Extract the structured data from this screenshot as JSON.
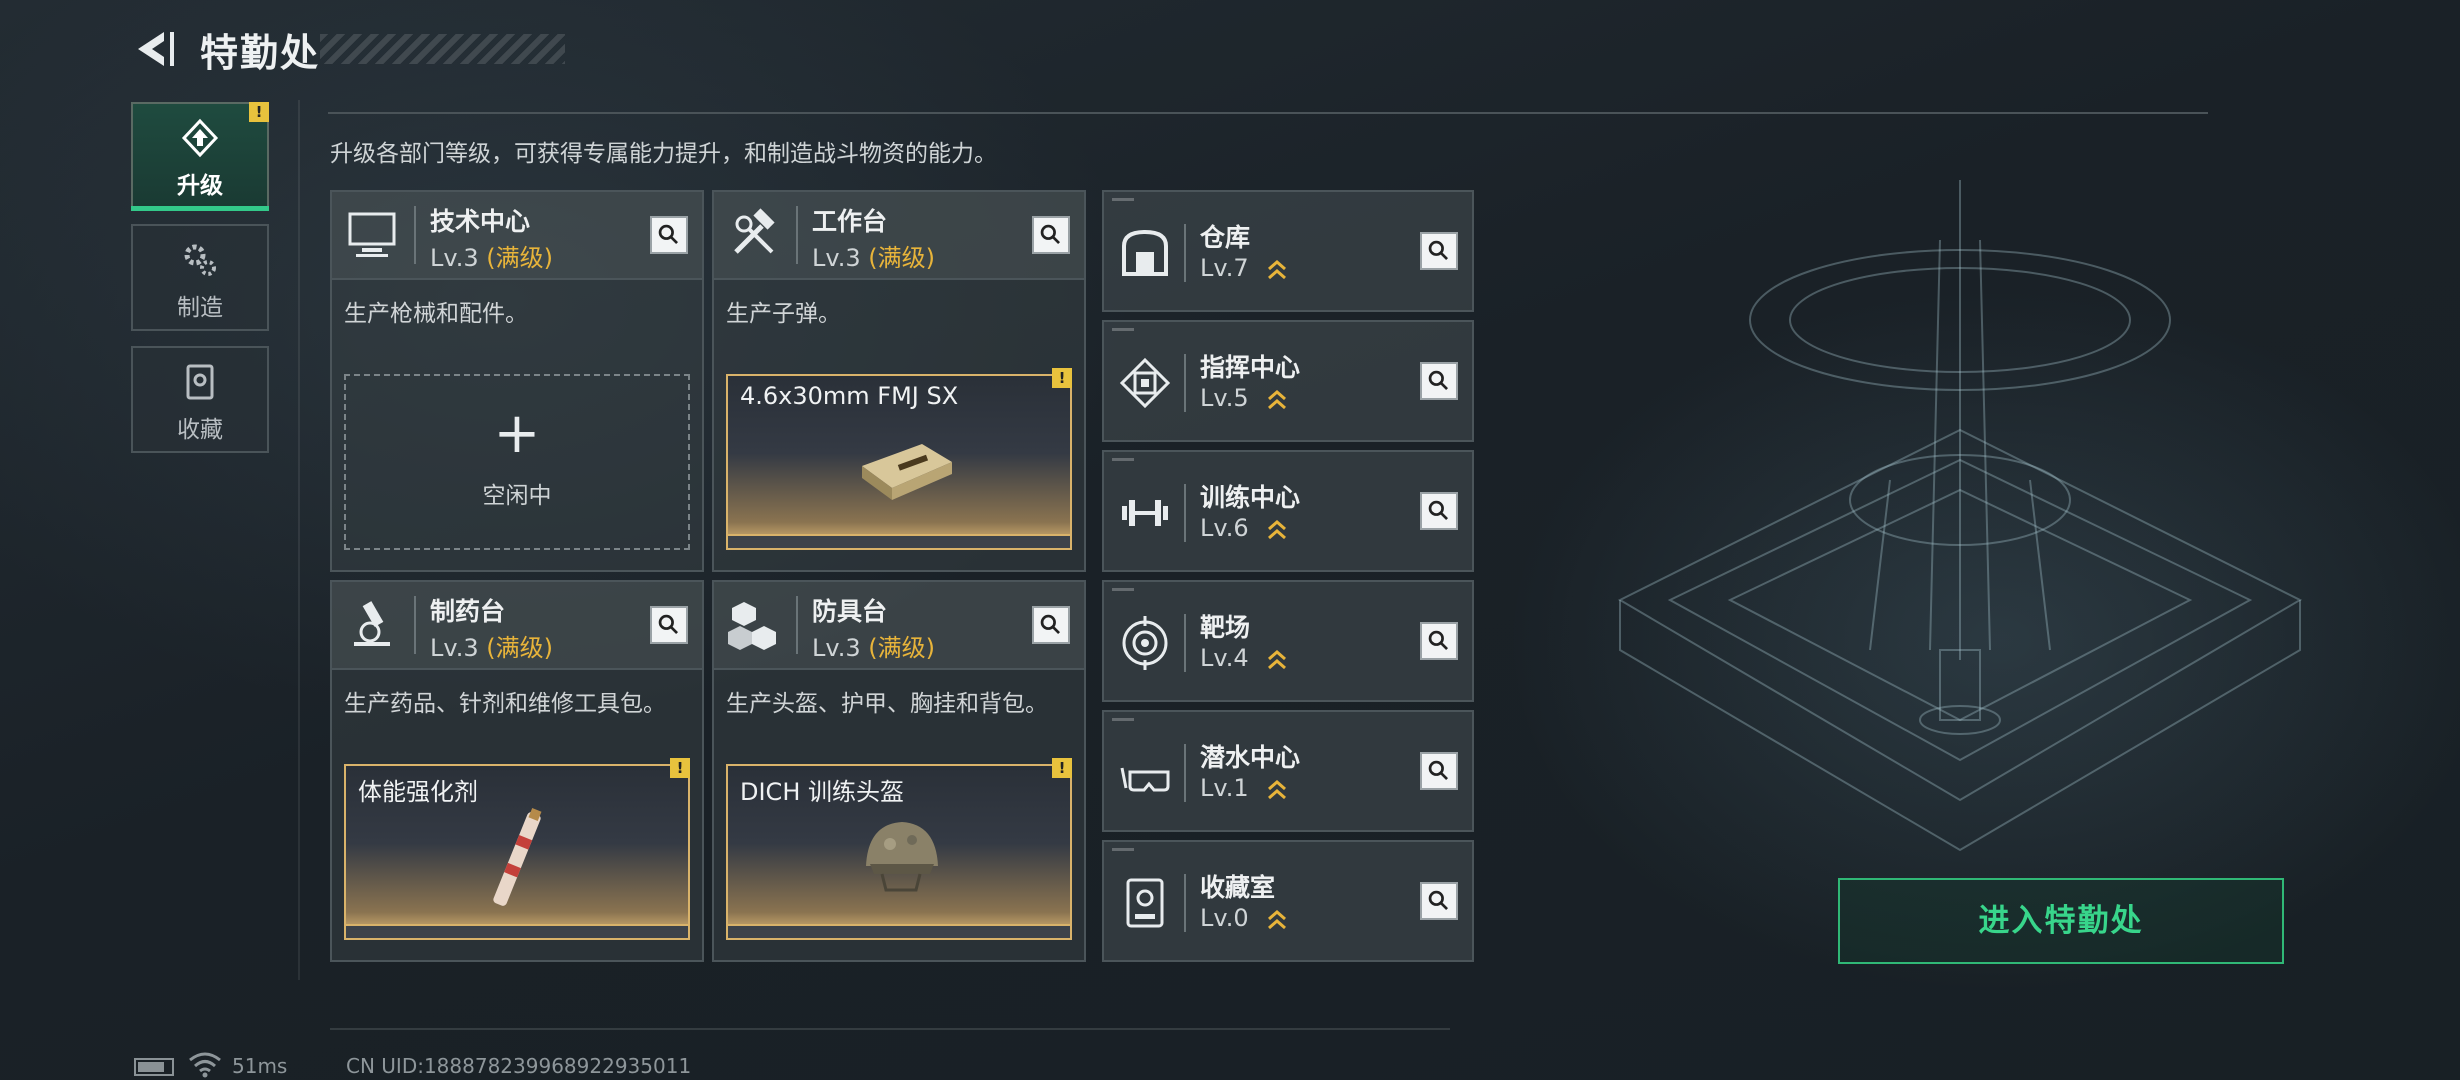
{
  "header": {
    "title": "特勤处"
  },
  "sidebar": {
    "items": [
      {
        "label": "升级",
        "active": true,
        "alert": "!"
      },
      {
        "label": "制造"
      },
      {
        "label": "收藏"
      }
    ]
  },
  "intro": "升级各部门等级，可获得专属能力提升，和制造战斗物资的能力。",
  "departments": [
    {
      "name": "技术中心",
      "level": "Lv.3",
      "max": "(满级)",
      "desc": "生产枪械和配件。",
      "slot": {
        "state": "idle",
        "plus": "+",
        "text": "空闲中"
      }
    },
    {
      "name": "工作台",
      "level": "Lv.3",
      "max": "(满级)",
      "desc": "生产子弹。",
      "slot": {
        "state": "producing",
        "item": "4.6x30mm FMJ SX",
        "alert": "!"
      }
    },
    {
      "name": "制药台",
      "level": "Lv.3",
      "max": "(满级)",
      "desc": "生产药品、针剂和维修工具包。",
      "slot": {
        "state": "producing",
        "item": "体能强化剂",
        "alert": "!"
      }
    },
    {
      "name": "防具台",
      "level": "Lv.3",
      "max": "(满级)",
      "desc": "生产头盔、护甲、胸挂和背包。",
      "slot": {
        "state": "producing",
        "item": "DICH 训练头盔",
        "alert": "!"
      }
    }
  ],
  "facilities": [
    {
      "name": "仓库",
      "level": "Lv.7",
      "icon": "warehouse-icon"
    },
    {
      "name": "指挥中心",
      "level": "Lv.5",
      "icon": "chip-icon"
    },
    {
      "name": "训练中心",
      "level": "Lv.6",
      "icon": "dumbbell-icon"
    },
    {
      "name": "靶场",
      "level": "Lv.4",
      "icon": "target-icon"
    },
    {
      "name": "潜水中心",
      "level": "Lv.1",
      "icon": "dive-mask-icon"
    },
    {
      "name": "收藏室",
      "level": "Lv.0",
      "icon": "collection-icon"
    }
  ],
  "enter_button": "进入特勤处",
  "footer": {
    "ping": "51ms",
    "uid": "CN UID:188878239968922935011"
  },
  "colors": {
    "accent_green": "#38d58b",
    "max_level": "#e8b43a",
    "alert": "#e8c23d"
  }
}
